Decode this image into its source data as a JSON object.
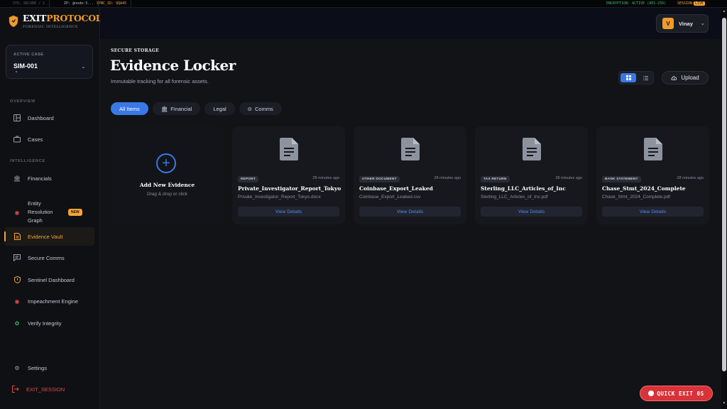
{
  "status_bar": {
    "seg1": "SYS: SECURE / 1",
    "seg2": "IP: @node:3...",
    "seg3": "SYNC_ID: 9QA45",
    "right1": "ENCRYPTION: ACTIVE (AES-256)",
    "right2_label": "SESSION:",
    "right2_badge": "LIVE"
  },
  "brand": {
    "name_a": "EXIT",
    "name_b": "PROTOCOL",
    "subtitle": "FORENSIC INTELLIGENCE"
  },
  "active_case": {
    "label": "ACTIVE CASE",
    "value": "SIM-001"
  },
  "sidebar": {
    "section_overview": "OVERVIEW",
    "section_intelligence": "INTELLIGENCE",
    "items": [
      {
        "label": "Dashboard",
        "icon": "dashboard-icon"
      },
      {
        "label": "Cases",
        "icon": "briefcase-icon"
      },
      {
        "label": "Financials",
        "icon": "bank-icon"
      },
      {
        "label": "Entity\nResolution\nGraph",
        "icon": "target-icon",
        "badge": "NEW"
      },
      {
        "label": "Evidence Vault",
        "icon": "document-icon"
      },
      {
        "label": "Secure Comms",
        "icon": "chat-icon"
      },
      {
        "label": "Sentinel Dashboard",
        "icon": "shield-icon"
      },
      {
        "label": "Impeachment Engine",
        "icon": "target-icon"
      },
      {
        "label": "Verify Integrity",
        "icon": "badge-check-icon"
      }
    ],
    "settings": "Settings",
    "exit_session": "EXIT_SESSION"
  },
  "user": {
    "initial": "V",
    "name": "Vinay"
  },
  "page": {
    "eyebrow": "SECURE STORAGE",
    "title": "Evidence Locker",
    "subtitle": "Immutable tracking for all forensic assets.",
    "upload": "Upload"
  },
  "filters": [
    {
      "label": "All Items",
      "icon": ""
    },
    {
      "label": "Financial",
      "icon": "bank-icon"
    },
    {
      "label": "Legal",
      "icon": ""
    },
    {
      "label": "Comms",
      "icon": "chat-icon"
    }
  ],
  "add_card": {
    "title": "Add New Evidence",
    "subtitle": "Drag & drop or click"
  },
  "evidence": [
    {
      "tag": "REPORT",
      "time": "28 minutes ago",
      "name": "Private_Investigator_Report_Tokyo",
      "file": "Private_Investigator_Report_Tokyo.docx",
      "action": "View Details"
    },
    {
      "tag": "OTHER DOCUMENT",
      "time": "28 minutes ago",
      "name": "Coinbase_Export_Leaked",
      "file": "Coinbase_Export_Leaked.csv",
      "action": "View Details"
    },
    {
      "tag": "TAX RETURN",
      "time": "28 minutes ago",
      "name": "Sterling_LLC_Articles_of_Inc",
      "file": "Sterling_LLC_Articles_of_Inc.pdf",
      "action": "View Details"
    },
    {
      "tag": "BANK STATEMENT",
      "time": "28 minutes ago",
      "name": "Chase_Stmt_2024_Complete",
      "file": "Chase_Stmt_2024_Complete.pdf",
      "action": "View Details"
    }
  ],
  "quick_exit": "QUICK EXIT 0S",
  "colors": {
    "accent": "#f5a23a",
    "primary": "#3a78e6",
    "danger": "#d8323a",
    "bg": "#111317"
  }
}
